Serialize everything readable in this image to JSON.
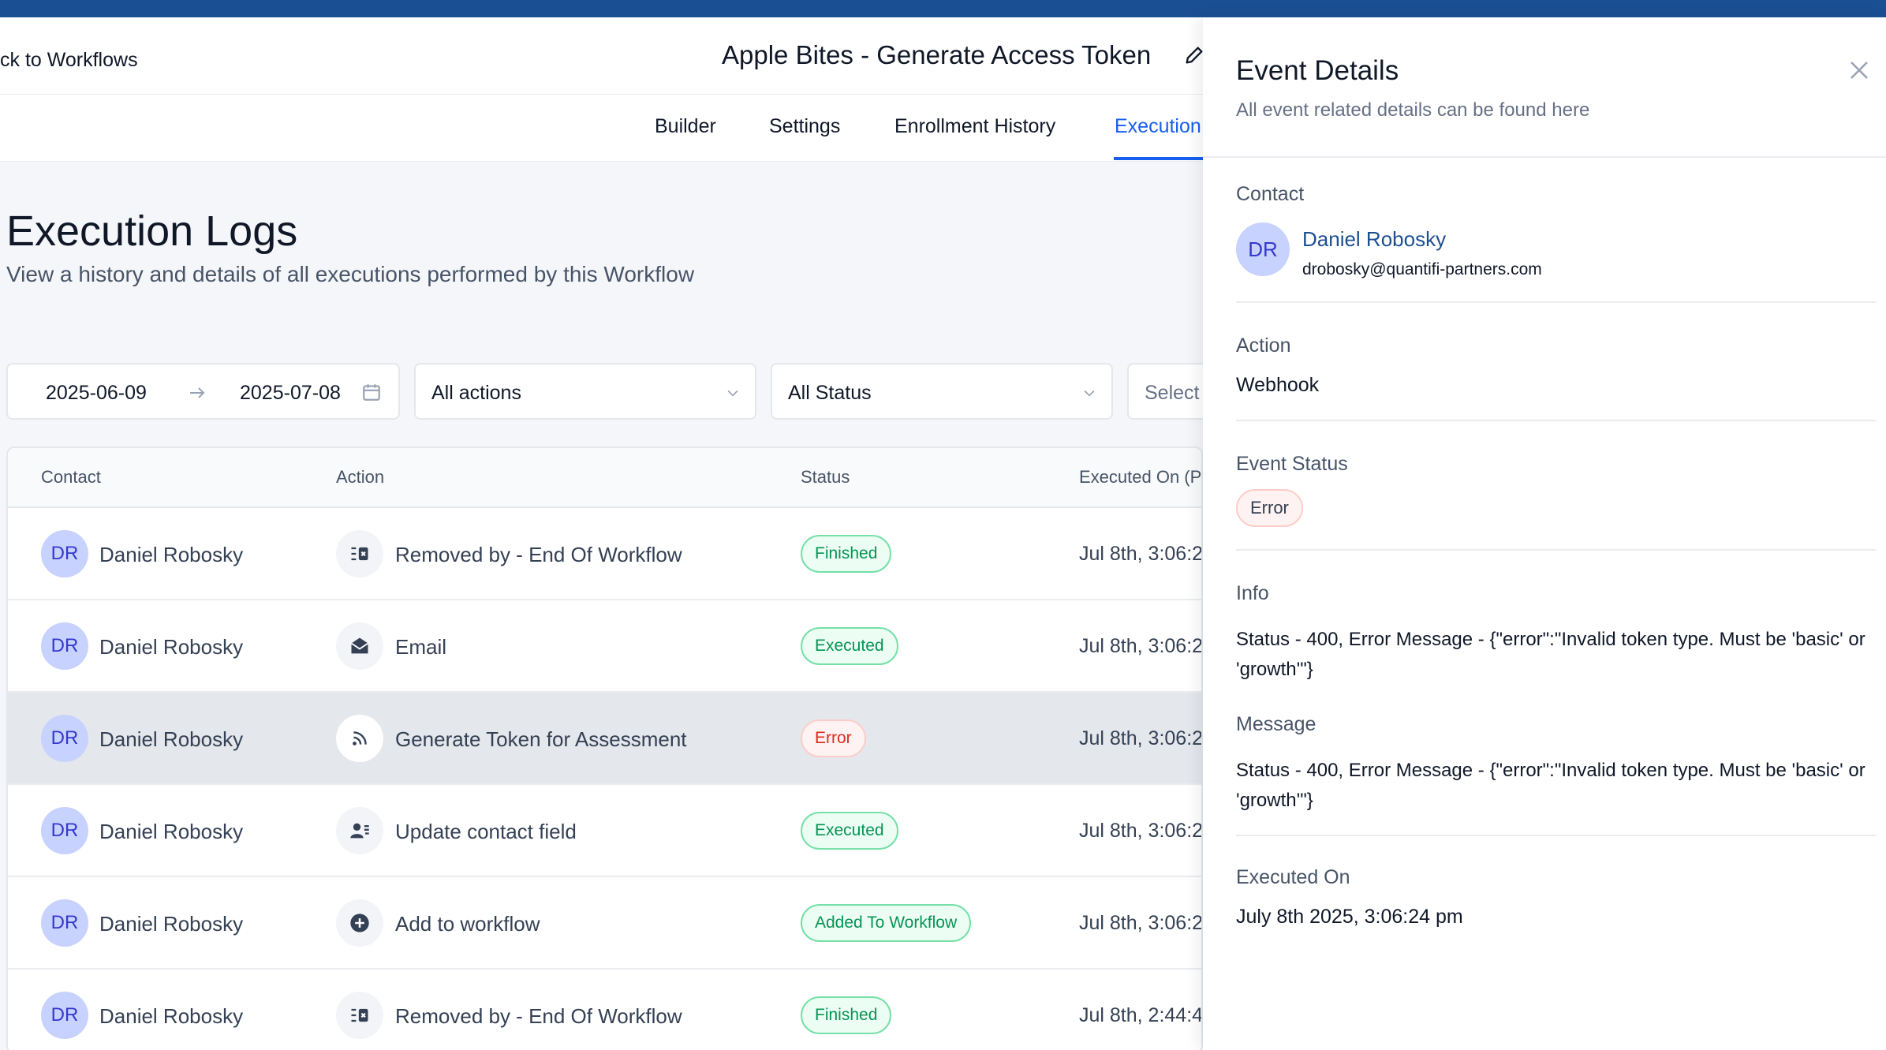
{
  "header": {
    "back_label": "ck to Workflows",
    "workflow_title": "Apple Bites - Generate Access Token"
  },
  "tabs": [
    {
      "label": "Builder"
    },
    {
      "label": "Settings"
    },
    {
      "label": "Enrollment History"
    },
    {
      "label": "Execution"
    }
  ],
  "page": {
    "title": "Execution Logs",
    "subtitle": "View a history and details of all executions performed by this Workflow"
  },
  "filters": {
    "date_from": "2025-06-09",
    "date_to": "2025-07-08",
    "actions_value": "All actions",
    "status_value": "All Status",
    "extra_placeholder": "Select"
  },
  "table": {
    "columns": [
      "Contact",
      "Action",
      "Status",
      "Executed On (PI"
    ],
    "rows": [
      {
        "initials": "DR",
        "contact": "Daniel Robosky",
        "action": "Removed by - End Of Workflow",
        "action_icon": "remove-list-icon",
        "status": "Finished",
        "status_kind": "green",
        "executed": "Jul 8th, 3:06:2"
      },
      {
        "initials": "DR",
        "contact": "Daniel Robosky",
        "action": "Email",
        "action_icon": "email-icon",
        "status": "Executed",
        "status_kind": "green",
        "executed": "Jul 8th, 3:06:2"
      },
      {
        "initials": "DR",
        "contact": "Daniel Robosky",
        "action": "Generate Token for Assessment",
        "action_icon": "webhook-icon",
        "status": "Error",
        "status_kind": "red",
        "executed": "Jul 8th, 3:06:2"
      },
      {
        "initials": "DR",
        "contact": "Daniel Robosky",
        "action": "Update contact field",
        "action_icon": "contact-field-icon",
        "status": "Executed",
        "status_kind": "green",
        "executed": "Jul 8th, 3:06:2"
      },
      {
        "initials": "DR",
        "contact": "Daniel Robosky",
        "action": "Add to workflow",
        "action_icon": "plus-circle-icon",
        "status": "Added To Workflow",
        "status_kind": "green",
        "executed": "Jul 8th, 3:06:2"
      },
      {
        "initials": "DR",
        "contact": "Daniel Robosky",
        "action": "Removed by - End Of Workflow",
        "action_icon": "remove-list-icon",
        "status": "Finished",
        "status_kind": "green",
        "executed": "Jul 8th, 2:44:4"
      }
    ]
  },
  "panel": {
    "title": "Event Details",
    "subtitle": "All event related details can be found here",
    "contact_label": "Contact",
    "contact_initials": "DR",
    "contact_name": "Daniel Robosky",
    "contact_email": "drobosky@quantifi-partners.com",
    "action_label": "Action",
    "action_value": "Webhook",
    "event_status_label": "Event Status",
    "event_status_value": "Error",
    "info_label": "Info",
    "info_text": "Status - 400, Error Message - {\"error\":\"Invalid token type. Must be 'basic' or 'growth'\"}",
    "message_label": "Message",
    "message_text": "Status - 400, Error Message - {\"error\":\"Invalid token type. Must be 'basic' or 'growth'\"}",
    "executed_on_label": "Executed On",
    "executed_on_value": "July 8th 2025, 3:06:24 pm"
  },
  "colors": {
    "topbar": "#1b4f93",
    "accent": "#155eef",
    "success": "#079455",
    "error": "#d92d20"
  }
}
